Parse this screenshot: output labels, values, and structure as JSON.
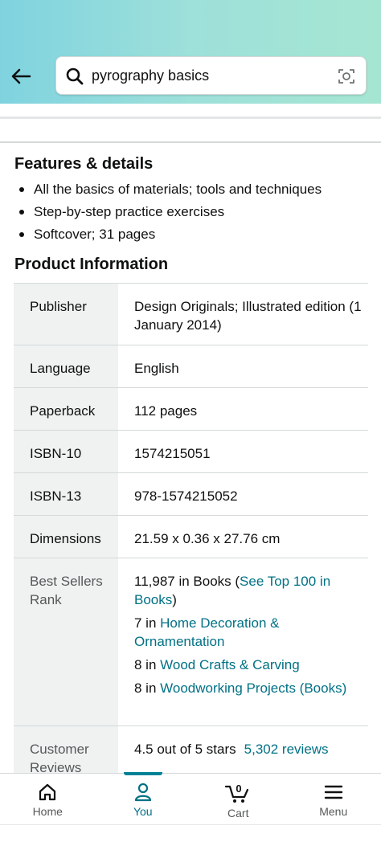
{
  "search": {
    "query": "pyrography basics"
  },
  "features": {
    "title": "Features & details",
    "items": [
      "All the basics of materials; tools and techniques",
      "Step-by-step practice exercises",
      "Softcover; 31 pages"
    ]
  },
  "product_info": {
    "title": "Product Information",
    "rows": [
      {
        "key": "Publisher",
        "value": "Design Originals; Illustrated edition (1 January 2014)"
      },
      {
        "key": "Language",
        "value": "English"
      },
      {
        "key": "Paperback",
        "value": "112 pages"
      },
      {
        "key": "ISBN-10",
        "value": "1574215051"
      },
      {
        "key": "ISBN-13",
        "value": "978-1574215052"
      },
      {
        "key": "Dimensions",
        "value": "21.59 x 0.36 x 27.76 cm"
      }
    ],
    "best_sellers": {
      "key": "Best Sellers Rank",
      "ranks": [
        {
          "prefix": "11,987 in Books (",
          "link": "See Top 100 in Books",
          "suffix": ")"
        },
        {
          "prefix": "7 in ",
          "link": "Home Decoration & Ornamentation",
          "suffix": ""
        },
        {
          "prefix": "8 in ",
          "link": "Wood Crafts & Carving",
          "suffix": ""
        },
        {
          "prefix": "8 in ",
          "link": "Woodworking Projects (Books)",
          "suffix": ""
        }
      ]
    },
    "customer_reviews": {
      "key": "Customer Reviews",
      "rating": "4.5 out of 5 stars",
      "count": "5,302",
      "count_label": "reviews"
    }
  },
  "nav": {
    "home": "Home",
    "you": "You",
    "cart": "Cart",
    "cart_count": "0",
    "menu": "Menu"
  },
  "colors": {
    "link": "#007185",
    "header_start": "#7fd3df",
    "header_end": "#a5e6d2",
    "active": "#008296"
  },
  "icons": [
    "back-arrow-icon",
    "search-icon",
    "camera-icon",
    "home-icon",
    "person-icon",
    "cart-icon",
    "menu-icon"
  ]
}
